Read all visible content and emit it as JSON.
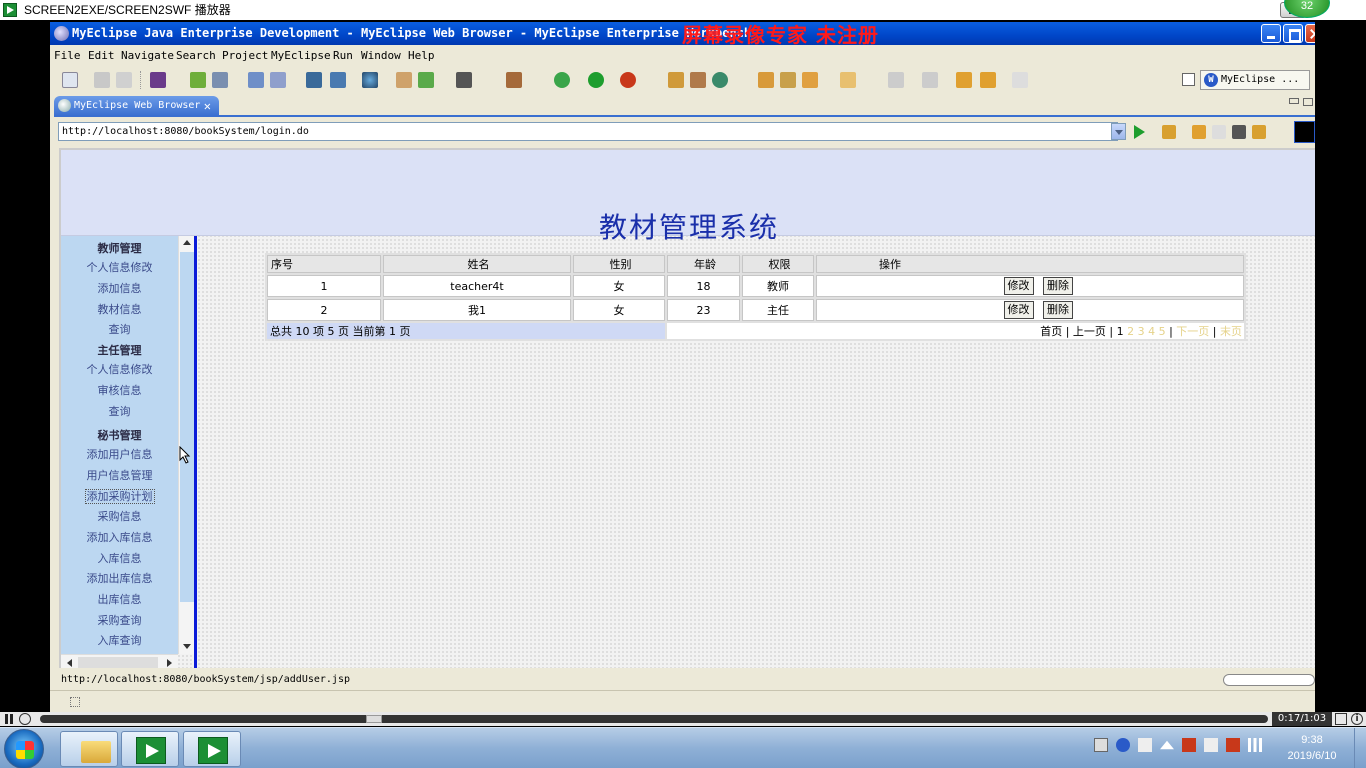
{
  "player": {
    "title": "SCREEN2EXE/SCREEN2SWF 播放器",
    "badge": "32",
    "time": "0:17/1:03",
    "info": "i"
  },
  "eclipse": {
    "title": "MyEclipse Java Enterprise Development - MyEclipse Web Browser - MyEclipse Enterprise Workbench",
    "watermark": "屏幕录像专家  未注册",
    "menu": [
      "File",
      "Edit",
      "Navigate",
      "Search",
      "Project",
      "MyEclipse",
      "Run",
      "Window",
      "Help"
    ],
    "perspective": "MyEclipse ...",
    "perspective_icon": "W",
    "tab_label": "MyEclipse Web Browser",
    "tab_close": "✕",
    "address": "http://localhost:8080/bookSystem/login.do",
    "status_url": "http://localhost:8080/bookSystem/jsp/addUser.jsp"
  },
  "page": {
    "banner_title": "教材管理系统",
    "sidebar": [
      {
        "label": "教师管理",
        "head": true
      },
      {
        "label": "个人信息修改"
      },
      {
        "label": "添加信息"
      },
      {
        "label": "教材信息"
      },
      {
        "label": "查询"
      },
      {
        "label": "主任管理",
        "head": true
      },
      {
        "label": "个人信息修改"
      },
      {
        "label": "审核信息"
      },
      {
        "label": "查询"
      },
      {
        "label": "秘书管理",
        "head": true
      },
      {
        "label": "添加用户信息"
      },
      {
        "label": "用户信息管理"
      },
      {
        "label": "添加采购计划",
        "focused": true
      },
      {
        "label": "采购信息"
      },
      {
        "label": "添加入库信息"
      },
      {
        "label": "入库信息"
      },
      {
        "label": "添加出库信息"
      },
      {
        "label": "出库信息"
      },
      {
        "label": "采购查询"
      },
      {
        "label": "入库查询"
      }
    ],
    "table": {
      "headers": [
        "序号",
        "姓名",
        "性别",
        "年龄",
        "权限",
        "操作"
      ],
      "rows": [
        {
          "no": "1",
          "name": "teacher4t",
          "gender": "女",
          "age": "18",
          "role": "教师"
        },
        {
          "no": "2",
          "name": "我1",
          "gender": "女",
          "age": "23",
          "role": "主任"
        }
      ],
      "edit_label": "修改",
      "delete_label": "删除",
      "summary": "总共 10 项 5 页 当前第 1 页",
      "pager": {
        "first": "首页",
        "sep1": " | ",
        "prev": "上一页",
        "sep2": " | ",
        "page1": "1",
        "pages_rest": " 2 3 4 5",
        "sep3": " | ",
        "next": "下一页",
        "sep4": " | ",
        "last": "末页"
      }
    }
  },
  "taskbar": {
    "time": "9:38",
    "date": "2019/6/10"
  }
}
